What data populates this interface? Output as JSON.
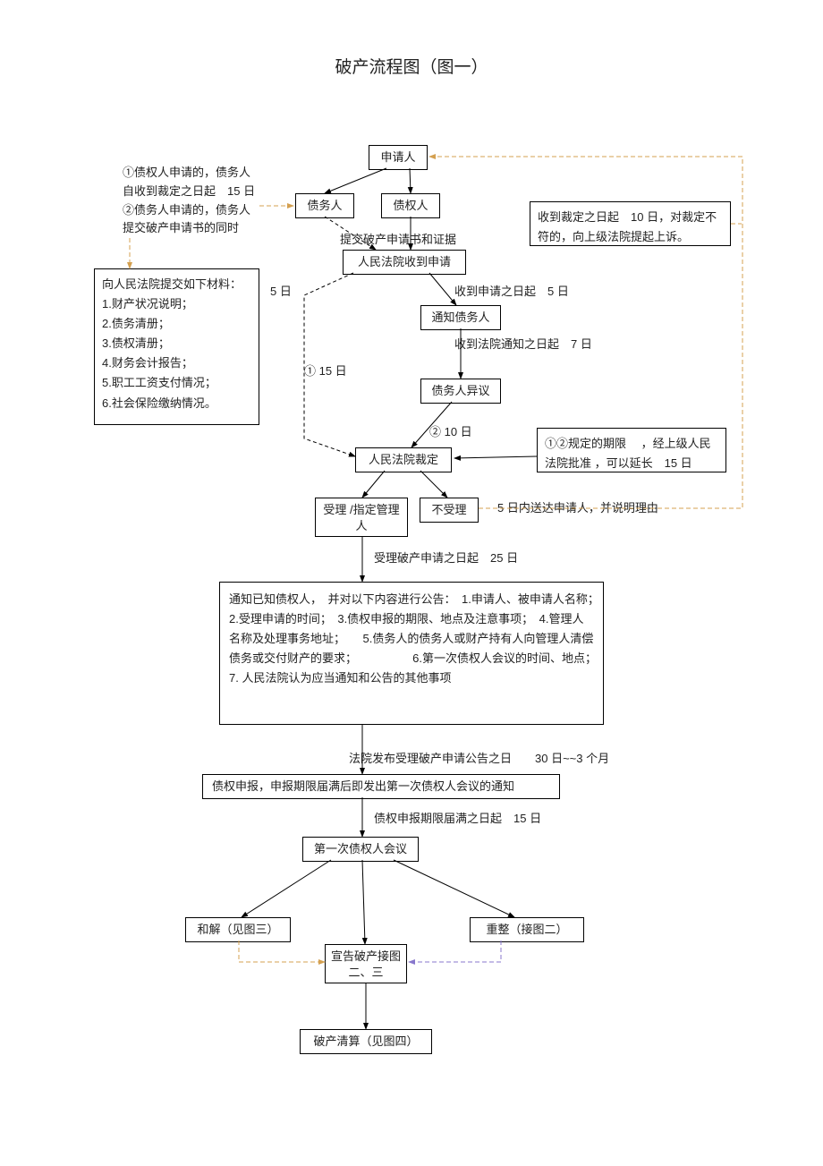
{
  "title": "破产流程图（图一）",
  "nodes": {
    "applicant": "申请人",
    "debtor": "债务人",
    "creditor": "债权人",
    "submit_docs": "提交破产申请书和证据",
    "court_receive": "人民法院收到申请",
    "notify_debtor": "通知债务人",
    "debtor_objection": "债务人异议",
    "court_ruling": "人民法院裁定",
    "accept": "受理 /指定管理人",
    "reject": "不受理",
    "notice_content": "通知已知债权人，　并对以下内容进行公告：　1.申请人、被申请人名称；　2.受理申请的时间；　3.债权申报的期限、地点及注意事项；　4.管理人名称及处理事务地址；　　5.债务人的债务人或财产持有人向管理人清偿债务或交付财产的要求；　　　　　 6.第一次债权人会议的时间、地点；　　7. 人民法院认为应当通知和公告的其他事项",
    "claim_filing": "债权申报，申报期限届满后即发出第一次债权人会议的通知",
    "first_meeting": "第一次债权人会议",
    "reconcile": "和解（见图三）",
    "declare": "宣告破产接图二、三",
    "reorganize": "重整（接图二）",
    "liquidation": "破产清算（见图四）"
  },
  "side_notes": {
    "top_left": "①债权人申请的，债务人自收到裁定之日起　15 日②债务人申请的，债务人提交破产申请书的同时",
    "top_left_line1": "①债权人申请的，债务人",
    "top_left_line2": "自收到裁定之日起　15 日",
    "top_left_line3": "②债务人申请的，债务人",
    "top_left_line4": "提交破产申请书的同时",
    "materials_title": "向人民法院提交如下材料：",
    "materials": [
      "1.财产状况说明；",
      "2.债务清册；",
      "3.债权清册；",
      "4.财务会计报告；",
      "5.职工工资支付情况；",
      "6.社会保险缴纳情况。"
    ],
    "appeal": "收到裁定之日起　10 日，对裁定不符的，向上级法院提起上诉。",
    "extend": "①②规定的期限　 ，经上级人民法院批准 ，可以延长　15 日",
    "reject_note": "5 日内送达申请人，并说明理由"
  },
  "edge_labels": {
    "five_days_left": "5 日",
    "receive_5days": "收到申请之日起　5 日",
    "notify_7days": "收到法院通知之日起　7 日",
    "fifteen_days": "① 15 日",
    "ten_days": "② 10 日",
    "accept_25days": "受理破产申请之日起　25 日",
    "publish_period": "法院发布受理破产申请公告之日　　30 日~~3 个月",
    "filing_15days": "债权申报期限届满之日起　15 日"
  },
  "chart_data": {
    "type": "flowchart",
    "nodes": [
      {
        "id": "applicant",
        "label": "申请人"
      },
      {
        "id": "debtor",
        "label": "债务人"
      },
      {
        "id": "creditor",
        "label": "债权人"
      },
      {
        "id": "court_receive",
        "label": "人民法院收到申请"
      },
      {
        "id": "notify_debtor",
        "label": "通知债务人"
      },
      {
        "id": "debtor_objection",
        "label": "债务人异议"
      },
      {
        "id": "court_ruling",
        "label": "人民法院裁定"
      },
      {
        "id": "accept",
        "label": "受理/指定管理人"
      },
      {
        "id": "reject",
        "label": "不受理"
      },
      {
        "id": "notice_content",
        "label": "公告内容"
      },
      {
        "id": "claim_filing",
        "label": "债权申报"
      },
      {
        "id": "first_meeting",
        "label": "第一次债权人会议"
      },
      {
        "id": "reconcile",
        "label": "和解（见图三）"
      },
      {
        "id": "declare",
        "label": "宣告破产接图二、三"
      },
      {
        "id": "reorganize",
        "label": "重整（接图二）"
      },
      {
        "id": "liquidation",
        "label": "破产清算（见图四）"
      }
    ],
    "edges": [
      {
        "from": "applicant",
        "to": "debtor"
      },
      {
        "from": "applicant",
        "to": "creditor"
      },
      {
        "from": "debtor",
        "to": "court_receive",
        "label": "提交破产申请书和证据",
        "style": "dashed"
      },
      {
        "from": "creditor",
        "to": "court_receive",
        "label": "提交破产申请书和证据"
      },
      {
        "from": "court_receive",
        "to": "notify_debtor",
        "label": "收到申请之日起 5 日"
      },
      {
        "from": "notify_debtor",
        "to": "debtor_objection",
        "label": "收到法院通知之日起 7 日"
      },
      {
        "from": "debtor_objection",
        "to": "court_ruling",
        "label": "② 10 日"
      },
      {
        "from": "court_receive",
        "to": "court_ruling",
        "label": "① 15 日",
        "style": "dashed",
        "note": "5 日"
      },
      {
        "from": "court_ruling",
        "to": "accept"
      },
      {
        "from": "court_ruling",
        "to": "reject"
      },
      {
        "from": "reject",
        "to": "applicant",
        "label": "5 日内送达申请人，并说明理由；收到裁定之日起 10 日，对裁定不符的，向上级法院提起上诉",
        "style": "dashed-orange"
      },
      {
        "from": "accept",
        "to": "notice_content",
        "label": "受理破产申请之日起 25 日"
      },
      {
        "from": "notice_content",
        "to": "claim_filing",
        "label": "法院发布受理破产申请公告之日 30 日~~3 个月"
      },
      {
        "from": "claim_filing",
        "to": "first_meeting",
        "label": "债权申报期限届满之日起 15 日"
      },
      {
        "from": "first_meeting",
        "to": "reconcile"
      },
      {
        "from": "first_meeting",
        "to": "declare"
      },
      {
        "from": "first_meeting",
        "to": "reorganize"
      },
      {
        "from": "reconcile",
        "to": "declare",
        "style": "dashed-orange"
      },
      {
        "from": "reorganize",
        "to": "declare",
        "style": "dashed-purple"
      },
      {
        "from": "declare",
        "to": "liquidation"
      }
    ],
    "side_notes": [
      {
        "text": "①债权人申请的，债务人自收到裁定之日起 15 日 ②债务人申请的，债务人提交破产申请书的同时",
        "links_to": "materials"
      },
      {
        "text": "向人民法院提交如下材料：1.财产状况说明；2.债务清册；3.债权清册；4.财务会计报告；5.职工工资支付情况；6.社会保险缴纳情况。"
      },
      {
        "text": "①②规定的期限，经上级人民法院批准，可以延长 15 日",
        "links_to": "court_ruling"
      }
    ]
  }
}
